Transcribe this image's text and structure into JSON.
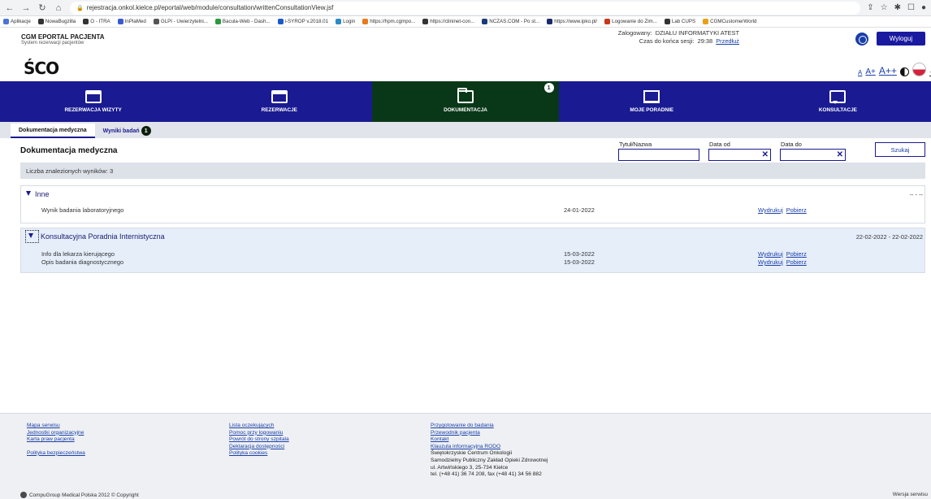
{
  "browser": {
    "url": "rejestracja.onkol.kielce.pl/eportal/web/module/consultation/writtenConsultationView.jsf",
    "bookmarks": [
      {
        "label": "Aplikacje",
        "color": "#4a74d8"
      },
      {
        "label": "NowaBugzilla",
        "color": "#333"
      },
      {
        "label": "O - ITRA",
        "color": "#333"
      },
      {
        "label": "InPlaMed",
        "color": "#3a5ad0"
      },
      {
        "label": "GLPI - Uwierzytelni...",
        "color": "#555"
      },
      {
        "label": "Bacula-Web - Dash...",
        "color": "#2a9a3a"
      },
      {
        "label": "i-SYROP v.2018.01",
        "color": "#1a5ac8"
      },
      {
        "label": "Login",
        "color": "#2a8ac8"
      },
      {
        "label": "https://hpm.cgmpo...",
        "color": "#e87a1a"
      },
      {
        "label": "https://clininet-con...",
        "color": "#333"
      },
      {
        "label": "NCZAS.COM - Po st...",
        "color": "#1a3a7a"
      },
      {
        "label": "https://www.ipko.pl/",
        "color": "#1a2a6a"
      },
      {
        "label": "Logowanie do Zim...",
        "color": "#c8381a"
      },
      {
        "label": "Lab CUPS",
        "color": "#333"
      },
      {
        "label": "CGMCustomerWorld",
        "color": "#e8a01a"
      }
    ]
  },
  "header": {
    "brand_title": "CGM EPORTAL PACJENTA",
    "brand_sub": "System rezerwacji pacjentów",
    "logged_label": "Zalogowany:",
    "logged_user": "DZIAŁU INFORMATYKI ATEST",
    "session_label": "Czas do końca sesji:",
    "session_time": "29:38",
    "extend_link": "Przedłuż",
    "logout": "Wyloguj",
    "logo": "ŚCO",
    "font_small": "A",
    "font_medium": "A+",
    "font_large": "A++"
  },
  "nav": {
    "tabs": [
      {
        "label": "REZERWACJA WIZYTY"
      },
      {
        "label": "REZERWACJE"
      },
      {
        "label": "DOKUMENTACJA",
        "badge": "1"
      },
      {
        "label": "MOJE PORADNIE"
      },
      {
        "label": "KONSULTACJE"
      }
    ]
  },
  "subtabs": [
    {
      "label": "Dokumentacja medyczna"
    },
    {
      "label": "Wyniki badań",
      "badge": "1"
    }
  ],
  "search": {
    "page_title": "Dokumentacja medyczna",
    "title_label": "Tytuł/Nazwa",
    "date_from_label": "Data od",
    "date_to_label": "Data do",
    "clear_symbol": "✕",
    "button": "Szukaj"
  },
  "results": {
    "count_text": "Liczba znalezionych wyników: 3",
    "groups": [
      {
        "title": "Inne",
        "date_range": "-- - --",
        "items": [
          {
            "name": "Wynik badania laboratoryjnego",
            "date": "24-01-2022",
            "print": "Wydrukuj",
            "download": "Pobierz"
          }
        ]
      },
      {
        "title": "Konsultacyjna Poradnia Internistyczna",
        "date_range": "22-02-2022 - 22-02-2022",
        "items": [
          {
            "name": "Info dla lekarza kierującego",
            "date": "15-03-2022",
            "print": "Wydrukuj",
            "download": "Pobierz"
          },
          {
            "name": "Opis badania diagnostycznego",
            "date": "15-03-2022",
            "print": "Wydrukuj",
            "download": "Pobierz"
          }
        ]
      }
    ]
  },
  "footer": {
    "col1": [
      "Mapa serwisu",
      "Jednostki organizacyjne",
      "Karta praw pacjenta",
      "Polityka bezpieczeństwa"
    ],
    "col2": [
      "Lista oczekujących",
      "Pomoc przy logowaniu",
      "Powrót do strony szpitala",
      "Deklaracja dostępności",
      "Polityka cookies"
    ],
    "col3_links": [
      "Przygotowanie do badania",
      "Przewodnik pacjenta",
      "Kontakt",
      "Klauzula informacyjna RODO"
    ],
    "col3_text": [
      "Świętokrzyskie Centrum Onkologii",
      "Samodzielny Publiczny Zakład Opieki Zdrowotnej",
      "ul. Artwińskiego 3, 25-734 Kielce",
      "tel. (+48 41) 36 74 208, fax (+48 41) 34 56 882"
    ],
    "copyright": "CompuGroup Medical Polska   2012 © Copyright",
    "version": "Wersja serwisu"
  }
}
